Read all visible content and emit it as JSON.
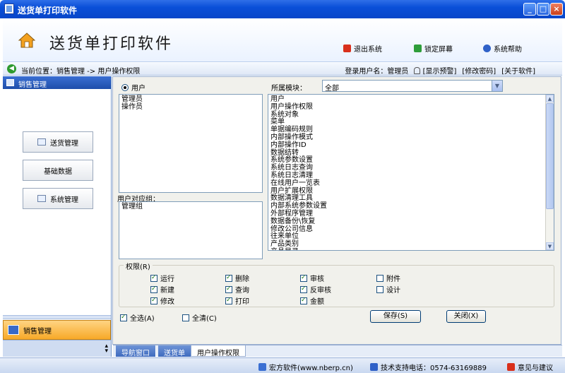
{
  "window": {
    "title": "送货单打印软件"
  },
  "header": {
    "title": "送货单打印软件",
    "links": [
      {
        "label": "退出系统",
        "color": "#d9301c"
      },
      {
        "label": "锁定屏幕",
        "color": "#2e9d3a"
      },
      {
        "label": "系统帮助",
        "color": "#2f61c8"
      }
    ]
  },
  "pathbar": {
    "location": "当前位置：销售管理 -> 用户操作权限",
    "login": "登录用户名：管理员",
    "show_alert": "[显示预警]",
    "change_password": "[修改密码]",
    "about": "[关于软件]"
  },
  "sidebar": {
    "header": "销售管理",
    "buttons": [
      "送货管理",
      "基础数据",
      "系统管理"
    ],
    "group": "销售管理"
  },
  "main": {
    "user_radio": "用户",
    "module_label": "所属模块：",
    "module_value": "全部",
    "users": [
      "管理员",
      "操作员"
    ],
    "group_label": "用户对应组：",
    "groups": [
      "管理组"
    ],
    "modules": [
      "用户",
      "用户操作权限",
      "系统对象",
      "菜单",
      "单据编码规则",
      "内部操作模式",
      "内部操作ID",
      "数据结转",
      "系统参数设置",
      "系统日志查询",
      "系统日志清理",
      "在线用户一览表",
      "用户扩展权限",
      "数据清理工具",
      "内部系统参数设置",
      "外部程序管理",
      "数据备份\\恢复",
      "修改公司信息",
      "往来单位",
      "产品类别",
      "产品目录"
    ],
    "permissions_title": "权限(R)",
    "permissions": [
      {
        "label": "运行",
        "checked": true
      },
      {
        "label": "删除",
        "checked": true
      },
      {
        "label": "审核",
        "checked": true
      },
      {
        "label": "附件",
        "checked": false
      },
      {
        "label": "新建",
        "checked": true
      },
      {
        "label": "查询",
        "checked": true
      },
      {
        "label": "反审核",
        "checked": true
      },
      {
        "label": "设计",
        "checked": false
      },
      {
        "label": "修改",
        "checked": true
      },
      {
        "label": "打印",
        "checked": true
      },
      {
        "label": "金额",
        "checked": true
      }
    ],
    "select_all": "全选(A)",
    "clear_all": "全清(C)",
    "save": "保存(S)",
    "close": "关闭(X)"
  },
  "tabs": [
    "导航窗口",
    "送货单",
    "用户操作权限"
  ],
  "status": {
    "company": "宏方软件(www.nberp.cn)",
    "support": "技术支持电话：0574-63169889",
    "feedback": "意见与建议"
  }
}
